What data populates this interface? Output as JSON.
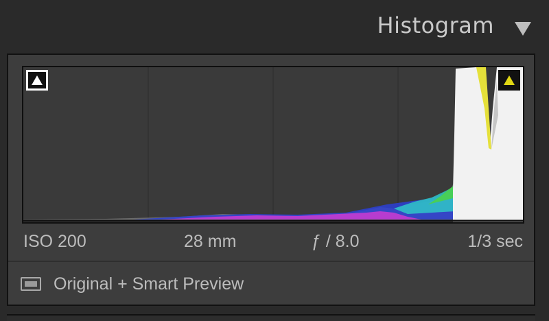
{
  "panel": {
    "title": "Histogram",
    "collapse_icon": "triangle-down-icon"
  },
  "histogram": {
    "shadow_clipping_icon": "triangle-up-icon",
    "highlight_clipping_icon": "triangle-up-icon",
    "highlight_clip_color": "#e0d714",
    "shadow_clip_color": "#ffffff",
    "gridlines": 4
  },
  "exif": {
    "iso": "ISO 200",
    "focal_length": "28 mm",
    "aperture": "ƒ / 8.0",
    "shutter": "1/3 sec"
  },
  "preview": {
    "icon": "smart-preview-icon",
    "label": "Original + Smart Preview"
  }
}
